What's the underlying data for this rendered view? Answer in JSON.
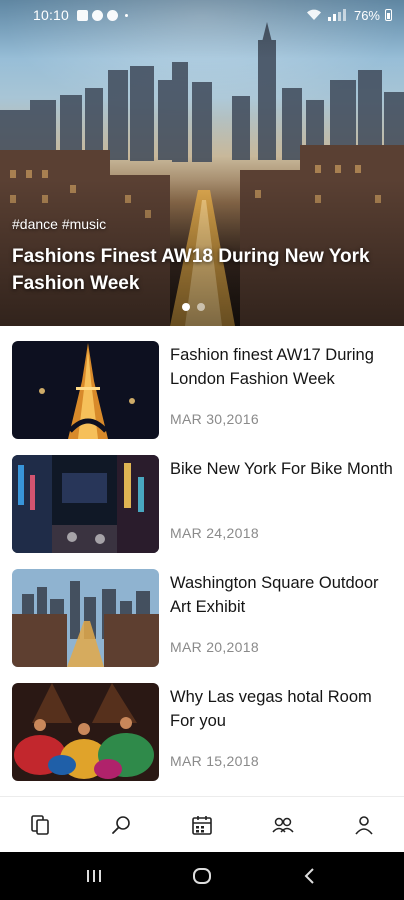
{
  "status_bar": {
    "time": "10:10",
    "battery": "76%",
    "icons": [
      "notification-icon",
      "phone-icon",
      "chat-icon",
      "wifi-icon",
      "signal-icon",
      "battery-icon"
    ]
  },
  "hero": {
    "tags": "#dance #music",
    "title": "Fashions Finest AW18 During New York Fashion Week",
    "page_count": 2,
    "active_page": 0
  },
  "articles": [
    {
      "title": "Fashion finest AW17 During London Fashion Week",
      "date": "MAR 30,2016",
      "image": "eiffel-tower-night"
    },
    {
      "title": "Bike New York For Bike Month",
      "date": "MAR 24,2018",
      "image": "city-street-night"
    },
    {
      "title": "Washington Square Outdoor Art Exhibit",
      "date": "MAR 20,2018",
      "image": "city-skyline-street"
    },
    {
      "title": "Why Las vegas hotal Room For you",
      "date": "MAR 15,2018",
      "image": "dancers-colorful"
    }
  ],
  "bottom_nav": [
    "pages-icon",
    "search-icon",
    "calendar-icon",
    "people-icon",
    "profile-icon"
  ],
  "system_nav": [
    "recents-icon",
    "home-icon",
    "back-icon"
  ],
  "colors": {
    "background": "#ffffff",
    "title_text": "#151515",
    "date_text": "#8a8a8a",
    "system_bar": "#000000"
  }
}
